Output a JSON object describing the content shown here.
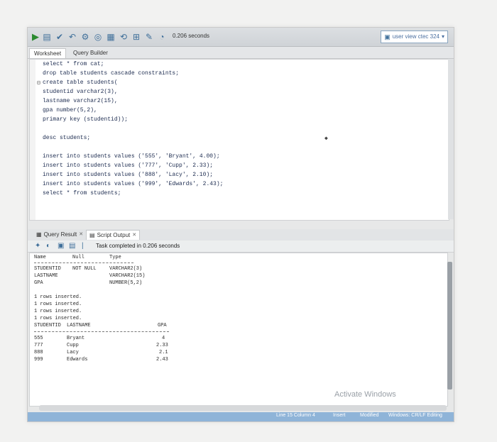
{
  "toolbar": {
    "elapsed": "0.206 seconds",
    "connection": "user view ctec 324"
  },
  "editor_tabs": [
    "Worksheet",
    "Query Builder"
  ],
  "editor_lines": [
    "select * from cat;",
    "drop table students cascade constraints;",
    "create table students(",
    "studentid varchar2(3),",
    "lastname varchar2(15),",
    "gpa number(5,2),",
    "primary key (studentid));",
    "",
    "desc students;",
    "",
    "insert into students values ('555', 'Bryant', 4.00);",
    "insert into students values ('777', 'Cupp', 2.33);",
    "insert into students values ('888', 'Lacy', 2.10);",
    "insert into students values ('999', 'Edwards', 2.43);",
    "select * from students;"
  ],
  "result_tabs": [
    "Query Result",
    "Script Output"
  ],
  "task_message": "Task completed in 0.206 seconds",
  "output": {
    "desc_header": [
      "Name",
      "Null",
      "Type"
    ],
    "desc_rows": [
      [
        "STUDENTID",
        "NOT NULL",
        "VARCHAR2(3)"
      ],
      [
        "LASTNAME",
        "",
        "VARCHAR2(15)"
      ],
      [
        "GPA",
        "",
        "NUMBER(5,2)"
      ]
    ],
    "messages": [
      "1 rows inserted.",
      "1 rows inserted.",
      "1 rows inserted.",
      "1 rows inserted."
    ],
    "select_header": [
      "STUDENTID",
      "LASTNAME",
      "GPA"
    ],
    "select_rows": [
      [
        "555",
        "Bryant",
        "4"
      ],
      [
        "777",
        "Cupp",
        "2.33"
      ],
      [
        "888",
        "Lacy",
        "2.1"
      ],
      [
        "999",
        "Edwards",
        "2.43"
      ]
    ]
  },
  "status": [
    "Line 15 Column 4",
    "Insert",
    "Modified",
    "Windows: CR/LF Editing"
  ],
  "watermark": "Activate Windows"
}
